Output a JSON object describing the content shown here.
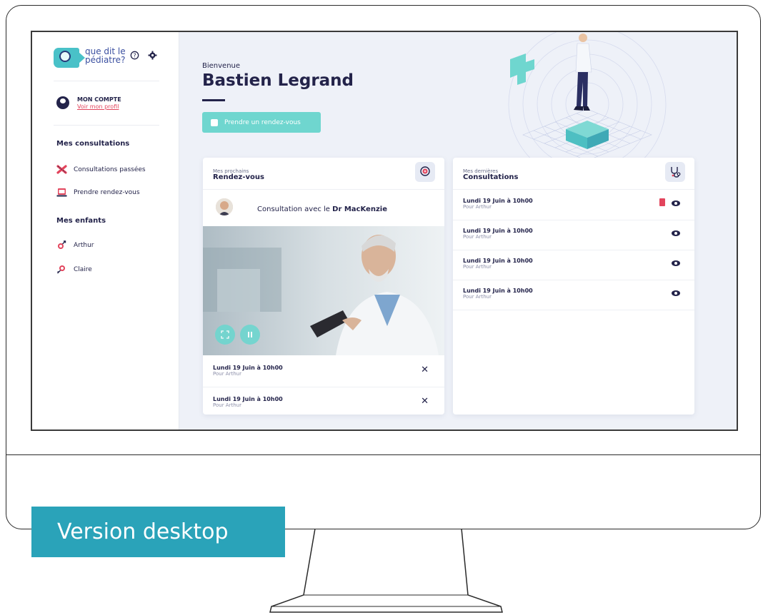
{
  "footer_tag": "Version desktop",
  "app": {
    "logo_text_line1": "que dit le",
    "logo_text_line2": "pédiatre?"
  },
  "sidebar": {
    "account_title": "MON COMPTE",
    "account_link": "Voir mon profil",
    "consultations_heading": "Mes consultations",
    "consultation_items": [
      {
        "label": "Consultations passées",
        "icon": "past-consultations-icon"
      },
      {
        "label": "Prendre rendez-vous",
        "icon": "book-appointment-icon"
      }
    ],
    "children_heading": "Mes enfants",
    "children": [
      {
        "label": "Arthur",
        "icon": "male-icon"
      },
      {
        "label": "Claire",
        "icon": "female-icon"
      }
    ]
  },
  "main": {
    "welcome": "Bienvenue",
    "user_name": "Bastien Legrand",
    "cta_label": "Prendre un rendez-vous"
  },
  "appointments": {
    "subtitle": "Mes prochains",
    "title": "Rendez-vous",
    "consult_prefix": "Consultation avec le",
    "consult_doctor": "Dr MacKenzie",
    "rows": [
      {
        "title": "Lundi 19 Juin à 10h00",
        "sub": "Pour Arthur"
      },
      {
        "title": "Lundi 19 Juin à 10h00",
        "sub": "Pour Arthur"
      }
    ]
  },
  "consultations": {
    "subtitle": "Mes dernières",
    "title": "Consultations",
    "rows": [
      {
        "title": "Lundi 19 Juin à 10h00",
        "sub": "Pour Arthur",
        "has_pdf": true
      },
      {
        "title": "Lundi 19 Juin à 10h00",
        "sub": "Pour Arthur",
        "has_pdf": false
      },
      {
        "title": "Lundi 19 Juin à 10h00",
        "sub": "Pour Arthur",
        "has_pdf": false
      },
      {
        "title": "Lundi 19 Juin à 10h00",
        "sub": "Pour Arthur",
        "has_pdf": false
      }
    ]
  },
  "colors": {
    "accent_teal": "#6fd6cf",
    "navy": "#23234a",
    "alert_red": "#e2445c",
    "tag_blue": "#2aa3b9"
  }
}
